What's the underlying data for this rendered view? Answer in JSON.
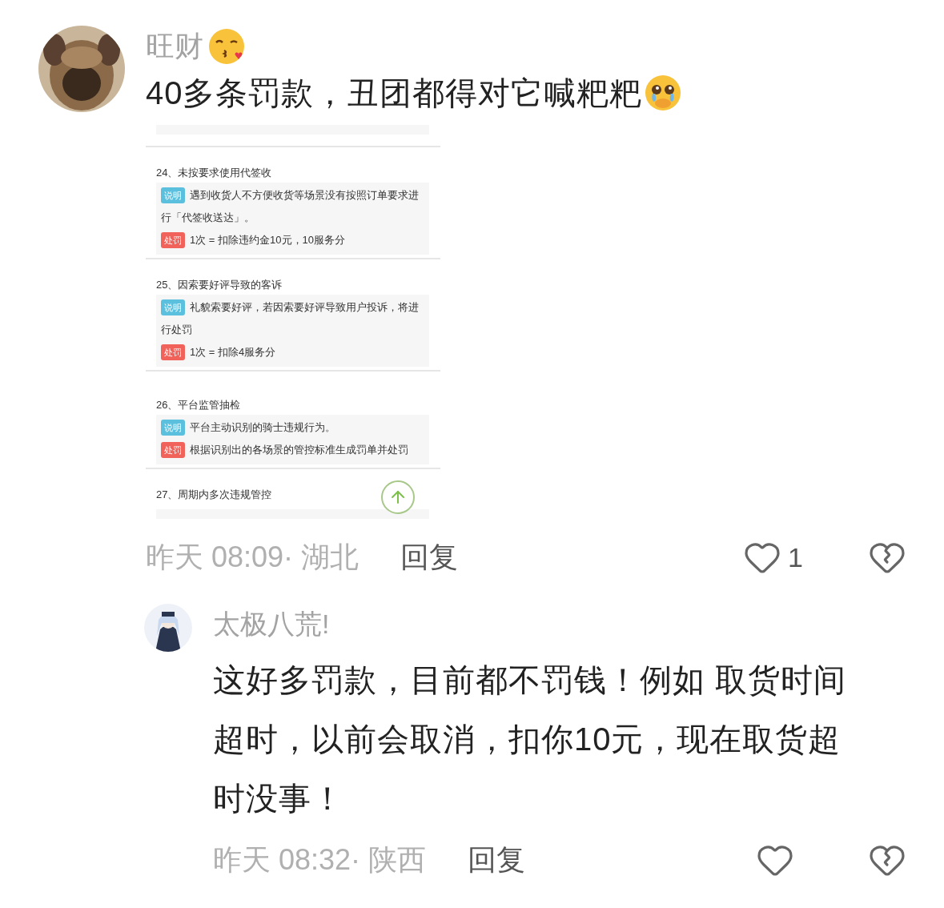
{
  "post": {
    "author": "旺财",
    "text": "40多条罚款，丑团都得对它喊粑粑",
    "screenshot": {
      "items": [
        {
          "title": "24、未按要求使用代签收",
          "rows": [
            {
              "kind": "note",
              "tag": "说明",
              "text": "遇到收货人不方便收货等场景没有按照订单要求进行「代签收送达」。"
            },
            {
              "kind": "penalty",
              "tag": "处罚",
              "text": "1次 = 扣除违约金10元，10服务分"
            }
          ]
        },
        {
          "title": "25、因索要好评导致的客诉",
          "rows": [
            {
              "kind": "note",
              "tag": "说明",
              "text": "礼貌索要好评，若因索要好评导致用户投诉，将进行处罚"
            },
            {
              "kind": "penalty",
              "tag": "处罚",
              "text": "1次 = 扣除4服务分"
            }
          ]
        },
        {
          "title": "26、平台监管抽检",
          "rows": [
            {
              "kind": "note",
              "tag": "说明",
              "text": "平台主动识别的骑士违规行为。"
            },
            {
              "kind": "penalty",
              "tag": "处罚",
              "text": "根据识别出的各场景的管控标准生成罚单并处罚"
            }
          ]
        },
        {
          "title": "27、周期内多次违规管控"
        }
      ]
    },
    "meta": "昨天 08:09· 湖北",
    "reply_label": "回复",
    "likes": "1",
    "liked": false
  },
  "reply": {
    "author": "太极八荒!",
    "text": "这好多罚款，目前都不罚钱！例如 取货时间超时，以前会取消，扣你10元，现在取货超时没事！",
    "meta": "昨天 08:32· 陕西",
    "reply_label": "回复",
    "liked": false
  }
}
